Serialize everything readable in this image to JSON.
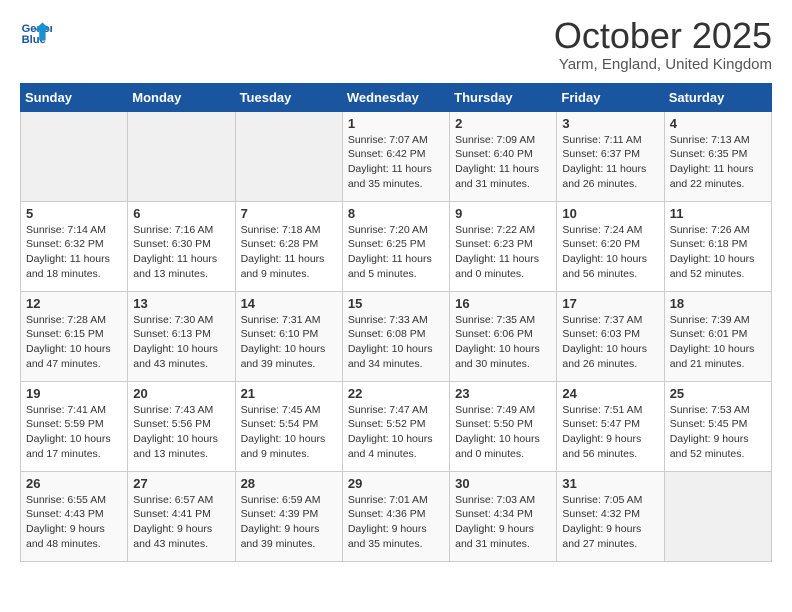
{
  "header": {
    "logo_line1": "General",
    "logo_line2": "Blue",
    "month": "October 2025",
    "location": "Yarm, England, United Kingdom"
  },
  "weekdays": [
    "Sunday",
    "Monday",
    "Tuesday",
    "Wednesday",
    "Thursday",
    "Friday",
    "Saturday"
  ],
  "weeks": [
    [
      {
        "day": "",
        "detail": ""
      },
      {
        "day": "",
        "detail": ""
      },
      {
        "day": "",
        "detail": ""
      },
      {
        "day": "1",
        "detail": "Sunrise: 7:07 AM\nSunset: 6:42 PM\nDaylight: 11 hours\nand 35 minutes."
      },
      {
        "day": "2",
        "detail": "Sunrise: 7:09 AM\nSunset: 6:40 PM\nDaylight: 11 hours\nand 31 minutes."
      },
      {
        "day": "3",
        "detail": "Sunrise: 7:11 AM\nSunset: 6:37 PM\nDaylight: 11 hours\nand 26 minutes."
      },
      {
        "day": "4",
        "detail": "Sunrise: 7:13 AM\nSunset: 6:35 PM\nDaylight: 11 hours\nand 22 minutes."
      }
    ],
    [
      {
        "day": "5",
        "detail": "Sunrise: 7:14 AM\nSunset: 6:32 PM\nDaylight: 11 hours\nand 18 minutes."
      },
      {
        "day": "6",
        "detail": "Sunrise: 7:16 AM\nSunset: 6:30 PM\nDaylight: 11 hours\nand 13 minutes."
      },
      {
        "day": "7",
        "detail": "Sunrise: 7:18 AM\nSunset: 6:28 PM\nDaylight: 11 hours\nand 9 minutes."
      },
      {
        "day": "8",
        "detail": "Sunrise: 7:20 AM\nSunset: 6:25 PM\nDaylight: 11 hours\nand 5 minutes."
      },
      {
        "day": "9",
        "detail": "Sunrise: 7:22 AM\nSunset: 6:23 PM\nDaylight: 11 hours\nand 0 minutes."
      },
      {
        "day": "10",
        "detail": "Sunrise: 7:24 AM\nSunset: 6:20 PM\nDaylight: 10 hours\nand 56 minutes."
      },
      {
        "day": "11",
        "detail": "Sunrise: 7:26 AM\nSunset: 6:18 PM\nDaylight: 10 hours\nand 52 minutes."
      }
    ],
    [
      {
        "day": "12",
        "detail": "Sunrise: 7:28 AM\nSunset: 6:15 PM\nDaylight: 10 hours\nand 47 minutes."
      },
      {
        "day": "13",
        "detail": "Sunrise: 7:30 AM\nSunset: 6:13 PM\nDaylight: 10 hours\nand 43 minutes."
      },
      {
        "day": "14",
        "detail": "Sunrise: 7:31 AM\nSunset: 6:10 PM\nDaylight: 10 hours\nand 39 minutes."
      },
      {
        "day": "15",
        "detail": "Sunrise: 7:33 AM\nSunset: 6:08 PM\nDaylight: 10 hours\nand 34 minutes."
      },
      {
        "day": "16",
        "detail": "Sunrise: 7:35 AM\nSunset: 6:06 PM\nDaylight: 10 hours\nand 30 minutes."
      },
      {
        "day": "17",
        "detail": "Sunrise: 7:37 AM\nSunset: 6:03 PM\nDaylight: 10 hours\nand 26 minutes."
      },
      {
        "day": "18",
        "detail": "Sunrise: 7:39 AM\nSunset: 6:01 PM\nDaylight: 10 hours\nand 21 minutes."
      }
    ],
    [
      {
        "day": "19",
        "detail": "Sunrise: 7:41 AM\nSunset: 5:59 PM\nDaylight: 10 hours\nand 17 minutes."
      },
      {
        "day": "20",
        "detail": "Sunrise: 7:43 AM\nSunset: 5:56 PM\nDaylight: 10 hours\nand 13 minutes."
      },
      {
        "day": "21",
        "detail": "Sunrise: 7:45 AM\nSunset: 5:54 PM\nDaylight: 10 hours\nand 9 minutes."
      },
      {
        "day": "22",
        "detail": "Sunrise: 7:47 AM\nSunset: 5:52 PM\nDaylight: 10 hours\nand 4 minutes."
      },
      {
        "day": "23",
        "detail": "Sunrise: 7:49 AM\nSunset: 5:50 PM\nDaylight: 10 hours\nand 0 minutes."
      },
      {
        "day": "24",
        "detail": "Sunrise: 7:51 AM\nSunset: 5:47 PM\nDaylight: 9 hours\nand 56 minutes."
      },
      {
        "day": "25",
        "detail": "Sunrise: 7:53 AM\nSunset: 5:45 PM\nDaylight: 9 hours\nand 52 minutes."
      }
    ],
    [
      {
        "day": "26",
        "detail": "Sunrise: 6:55 AM\nSunset: 4:43 PM\nDaylight: 9 hours\nand 48 minutes."
      },
      {
        "day": "27",
        "detail": "Sunrise: 6:57 AM\nSunset: 4:41 PM\nDaylight: 9 hours\nand 43 minutes."
      },
      {
        "day": "28",
        "detail": "Sunrise: 6:59 AM\nSunset: 4:39 PM\nDaylight: 9 hours\nand 39 minutes."
      },
      {
        "day": "29",
        "detail": "Sunrise: 7:01 AM\nSunset: 4:36 PM\nDaylight: 9 hours\nand 35 minutes."
      },
      {
        "day": "30",
        "detail": "Sunrise: 7:03 AM\nSunset: 4:34 PM\nDaylight: 9 hours\nand 31 minutes."
      },
      {
        "day": "31",
        "detail": "Sunrise: 7:05 AM\nSunset: 4:32 PM\nDaylight: 9 hours\nand 27 minutes."
      },
      {
        "day": "",
        "detail": ""
      }
    ]
  ]
}
